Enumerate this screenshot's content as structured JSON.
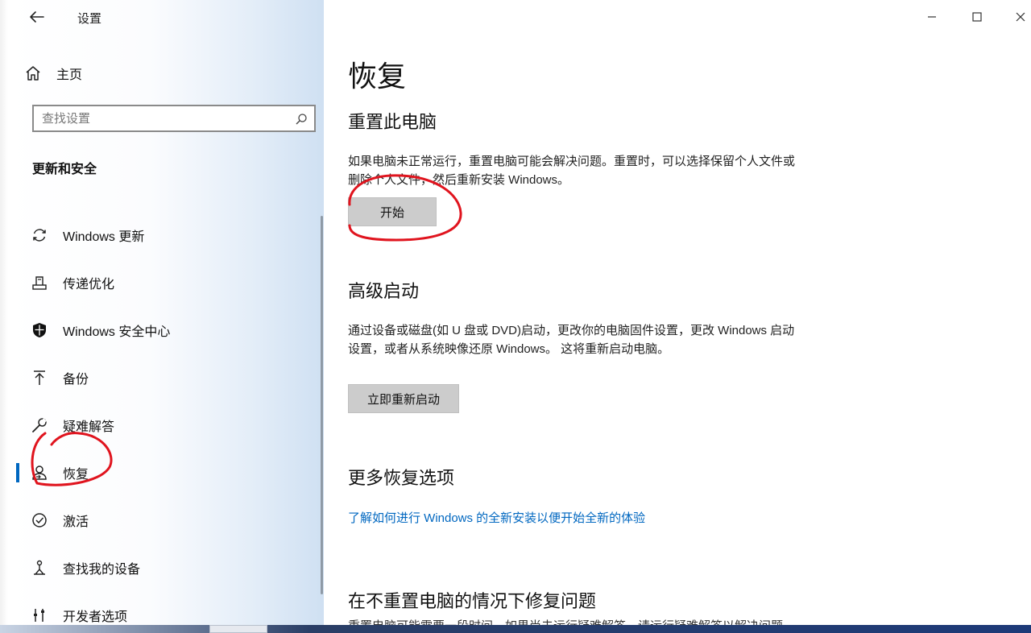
{
  "sidebar": {
    "app_title": "设置",
    "home_label": "主页",
    "search_placeholder": "查找设置",
    "section_heading": "更新和安全",
    "items": [
      {
        "label": "Windows 更新",
        "icon": "sync-icon"
      },
      {
        "label": "传递优化",
        "icon": "delivery-optimization-icon"
      },
      {
        "label": "Windows 安全中心",
        "icon": "shield-icon"
      },
      {
        "label": "备份",
        "icon": "backup-upload-icon"
      },
      {
        "label": "疑难解答",
        "icon": "wrench-icon"
      },
      {
        "label": "恢复",
        "icon": "recovery-person-icon",
        "selected": true
      },
      {
        "label": "激活",
        "icon": "check-circle-icon"
      },
      {
        "label": "查找我的设备",
        "icon": "find-device-person-icon"
      },
      {
        "label": "开发者选项",
        "icon": "developer-tools-icon"
      }
    ]
  },
  "main": {
    "title": "恢复",
    "reset": {
      "heading": "重置此电脑",
      "description": "如果电脑未正常运行，重置电脑可能会解决问题。重置时，可以选择保留个人文件或删除个人文件，然后重新安装 Windows。",
      "button": "开始"
    },
    "advanced": {
      "heading": "高级启动",
      "description": "通过设备或磁盘(如 U 盘或 DVD)启动，更改你的电脑固件设置，更改 Windows 启动设置，或者从系统映像还原 Windows。 这将重新启动电脑。",
      "button": "立即重新启动"
    },
    "more": {
      "heading": "更多恢复选项",
      "link": "了解如何进行 Windows 的全新安装以便开始全新的体验"
    },
    "fix": {
      "heading": "在不重置电脑的情况下修复问题",
      "partial_text": "重置电脑可能需要一段时间。如果尚未运行疑难解答，请运行疑难解答以解决问题"
    }
  },
  "colors": {
    "accent": "#0067c0",
    "annotation": "#e0141e",
    "button_bg": "#cccccc"
  }
}
